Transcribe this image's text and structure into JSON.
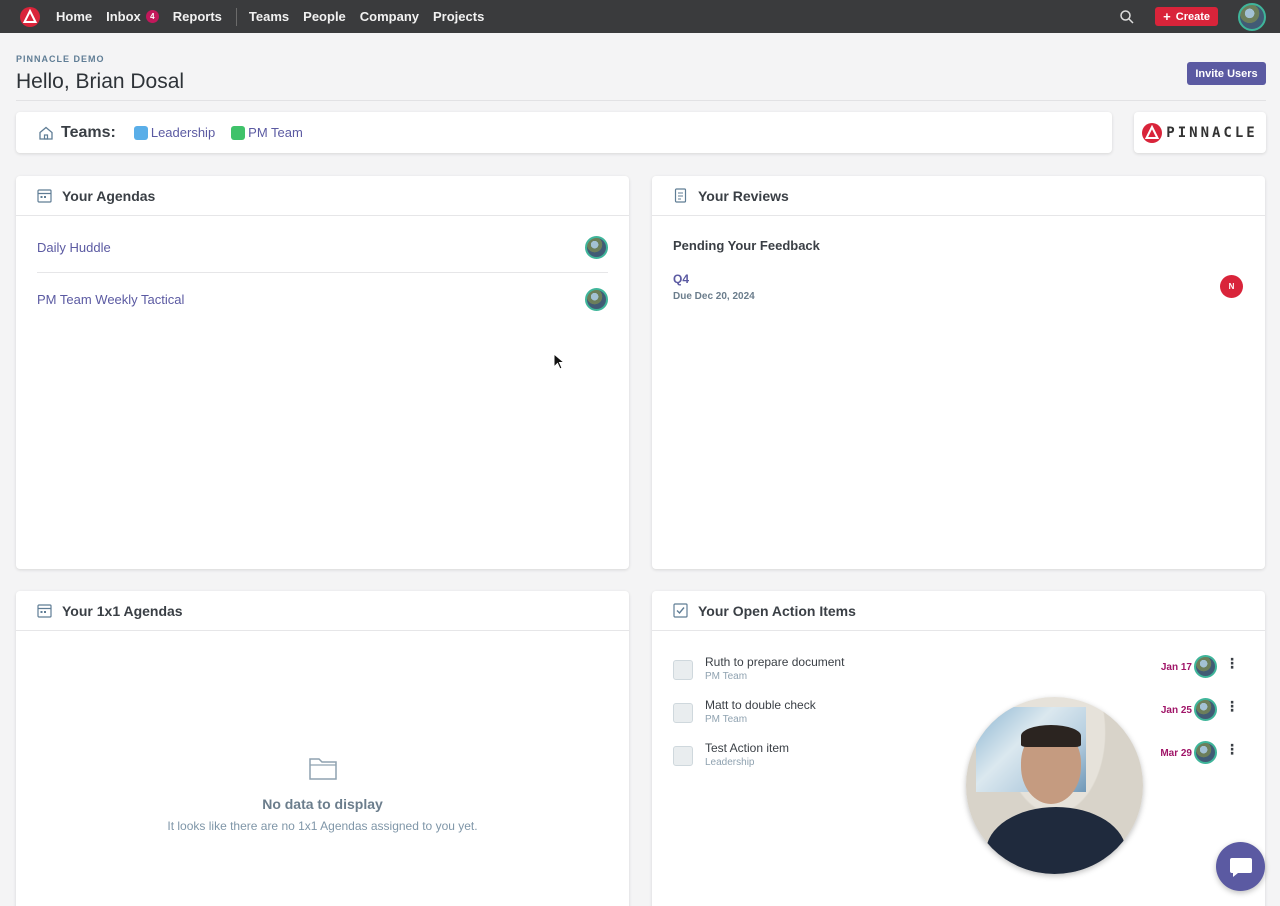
{
  "nav": {
    "items": [
      {
        "label": "Home"
      },
      {
        "label": "Inbox",
        "badge": "4"
      },
      {
        "label": "Reports"
      },
      {
        "label": "Teams"
      },
      {
        "label": "People"
      },
      {
        "label": "Company"
      },
      {
        "label": "Projects"
      }
    ],
    "create_label": "Create"
  },
  "header": {
    "org": "PINNACLE DEMO",
    "greeting": "Hello, Brian Dosal",
    "invite_label": "Invite Users"
  },
  "teams": {
    "label": "Teams:",
    "items": [
      {
        "name": "Leadership",
        "color": "#5aaee8"
      },
      {
        "name": "PM Team",
        "color": "#3fc26a"
      }
    ]
  },
  "logo_text": "PINNACLE",
  "agendas": {
    "title": "Your Agendas",
    "items": [
      {
        "name": "Daily Huddle"
      },
      {
        "name": "PM Team Weekly Tactical"
      }
    ]
  },
  "reviews": {
    "title": "Your Reviews",
    "section": "Pending Your Feedback",
    "items": [
      {
        "name": "Q4",
        "due": "Due Dec 20, 2024",
        "initial": "N"
      }
    ]
  },
  "one_on_one": {
    "title": "Your 1x1 Agendas",
    "empty_title": "No data to display",
    "empty_sub": "It looks like there are no 1x1 Agendas assigned to you yet."
  },
  "actions": {
    "title": "Your Open Action Items",
    "items": [
      {
        "title": "Ruth to prepare document",
        "team": "PM Team",
        "date": "Jan 17"
      },
      {
        "title": "Matt to double check",
        "team": "PM Team",
        "date": "Jan 25"
      },
      {
        "title": "Test Action item",
        "team": "Leadership",
        "date": "Mar 29"
      }
    ]
  },
  "colors": {
    "accent": "#5b5aa2",
    "create": "#d9243a",
    "due_date": "#a01568"
  }
}
